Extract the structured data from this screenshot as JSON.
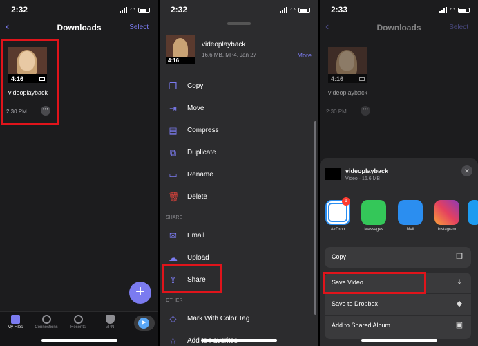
{
  "panel1": {
    "time": "2:32",
    "title": "Downloads",
    "select": "Select",
    "file": {
      "duration": "4:16",
      "name": "videoplayback",
      "time": "2:30 PM"
    },
    "tabs": [
      "My Files",
      "Connections",
      "Recents",
      "VPN"
    ],
    "fab": "+"
  },
  "panel2": {
    "time": "2:32",
    "header": {
      "name": "videoplayback",
      "meta": "16.6 MB, MP4, Jan 27",
      "more": "More",
      "duration": "4:16"
    },
    "items": [
      "Copy",
      "Move",
      "Compress",
      "Duplicate",
      "Rename",
      "Delete"
    ],
    "share_section": "SHARE",
    "share_items": [
      "Email",
      "Upload",
      "Share"
    ],
    "other_section": "OTHER",
    "other_items": [
      "Mark With Color Tag",
      "Add to Favorites"
    ]
  },
  "panel3": {
    "time": "2:33",
    "title": "Downloads",
    "select": "Select",
    "file": {
      "duration": "4:16",
      "name": "videoplayback",
      "time": "2:30 PM"
    },
    "sheet": {
      "name": "videoplayback",
      "meta": "Video · 16.6 MB",
      "apps": [
        "AirDrop",
        "Messages",
        "Mail",
        "Instagram"
      ],
      "airdrop_badge": "1",
      "actions": [
        "Copy",
        "Save Video",
        "Save to Dropbox",
        "Add to Shared Album"
      ]
    }
  },
  "colors": {
    "accent": "#7b7bf0",
    "highlight": "#e0141b",
    "delete": "#e0443c"
  }
}
